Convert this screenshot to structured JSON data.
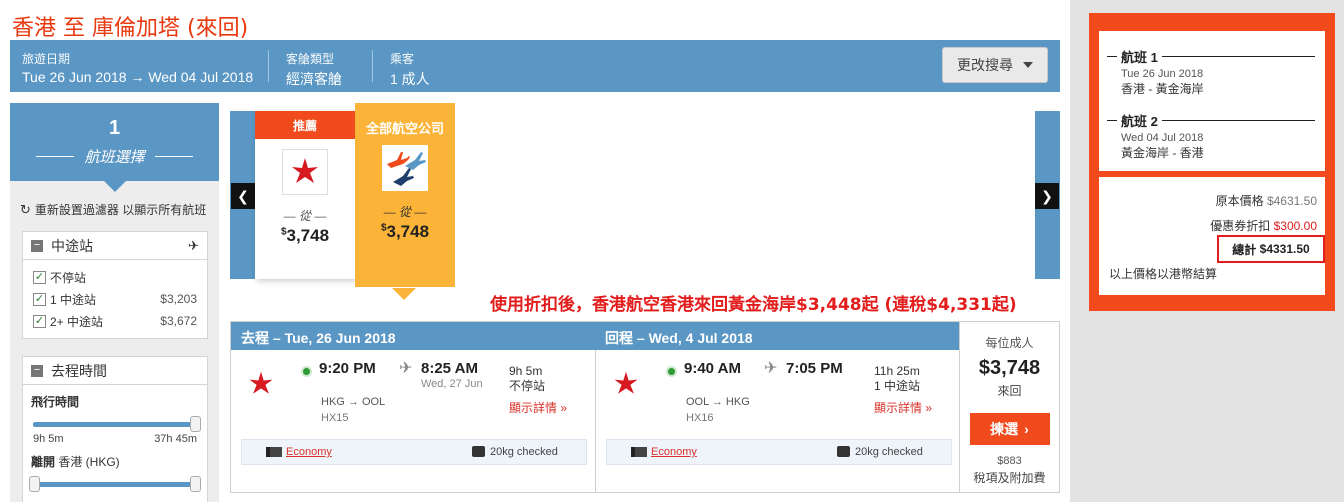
{
  "page": {
    "title": "香港 至 庫倫加塔 (來回)"
  },
  "search": {
    "dates_label": "旅遊日期",
    "dates_value": "Tue 26 Jun 2018 → Wed 04 Jul 2018",
    "cabin_label": "客艙類型",
    "cabin_value": "經濟客艙",
    "pax_label": "乘客",
    "pax_value": "1 成人",
    "modify_label": "更改搜尋"
  },
  "steps": {
    "number": "1",
    "title": "航班選擇"
  },
  "filters": {
    "reset_label": "重新設置過濾器 以顯示所有航班",
    "stops": {
      "title": "中途站",
      "options": [
        {
          "label": "不停站",
          "price": ""
        },
        {
          "label": "1 中途站",
          "price": "$3,203"
        },
        {
          "label": "2+ 中途站",
          "price": "$3,672"
        }
      ]
    },
    "depart_time": {
      "title": "去程時間",
      "flight_time_label": "飛行時間",
      "min": "9h 5m",
      "max": "37h 45m",
      "depart_label": "離開 香港 (HKG)"
    }
  },
  "airlines": [
    {
      "tag": "推薦",
      "from": "— 從 —",
      "currency": "$",
      "price": "3,748"
    },
    {
      "tag": "全部航空公司",
      "from": "— 從 —",
      "currency": "$",
      "price": "3,748"
    }
  ],
  "promo_text": "使用折扣後，香港航空香港來回黃金海岸$3,448起 (連稅$4,331起)",
  "result": {
    "outbound": {
      "header": "去程 – Tue, 26 Jun 2018",
      "dep_time": "9:20 PM",
      "arr_time": "8:25 AM",
      "arr_date": "Wed, 27 Jun",
      "route": "HKG → OOL",
      "flight_no": "HX15",
      "duration": "9h 5m",
      "stops": "不停站",
      "details": "顯示詳情 »",
      "cabin": "Economy",
      "baggage": "20kg checked"
    },
    "inbound": {
      "header": "回程 – Wed, 4 Jul 2018",
      "dep_time": "9:40 AM",
      "arr_time": "7:05 PM",
      "route": "OOL → HKG",
      "flight_no": "HX16",
      "duration": "11h 25m",
      "stops": "1 中途站",
      "details": "顯示詳情 »",
      "cabin": "Economy",
      "baggage": "20kg checked"
    },
    "price": {
      "per_adult": "每位成人",
      "amount": "$3,748",
      "trip": "來回",
      "select_label": "揀選",
      "tax_amount": "$883",
      "tax_label": "稅項及附加費"
    }
  },
  "summary": {
    "flight1": {
      "title": "航班 1",
      "date": "Tue 26 Jun 2018",
      "route": "香港 - 黃金海岸"
    },
    "flight2": {
      "title": "航班 2",
      "date": "Wed 04 Jul 2018",
      "route": "黃金海岸 - 香港"
    },
    "original_label": "原本價格",
    "original_value": "$4631.50",
    "discount_label": "優惠券折扣",
    "discount_value": "$300.00",
    "total_label": "總計",
    "total_value": "$4331.50",
    "note": "以上價格以港幣結算"
  },
  "colors": {
    "brand_blue": "#5b97c4",
    "accent_orange": "#f24a1d",
    "highlight_yellow": "#fbb437",
    "promo_red": "#e31c1c"
  }
}
